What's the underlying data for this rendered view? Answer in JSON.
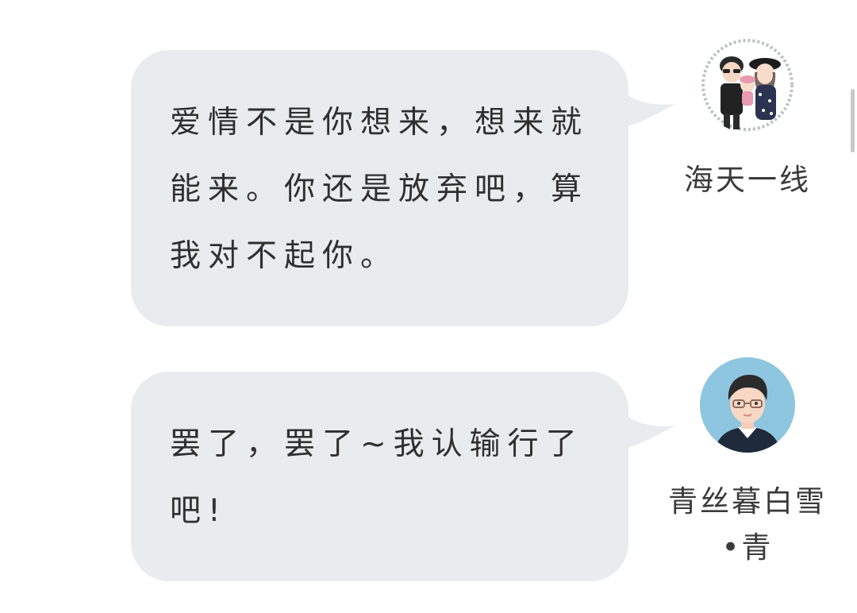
{
  "messages": [
    {
      "text": "爱情不是你想来，想来就能来。你还是放弃吧，算我对不起你。",
      "sender": "海天一线",
      "avatar_icon": "couple-cartoon-avatar-icon"
    },
    {
      "text": "罢了，罢了~我认输行了吧!",
      "sender": "青丝暮白雪•青",
      "avatar_icon": "man-with-glasses-avatar-icon"
    }
  ],
  "colors": {
    "bubble_bg": "#e9ecef",
    "text": "#2f2f2f",
    "avatar2_bg": "#8fc6df"
  }
}
